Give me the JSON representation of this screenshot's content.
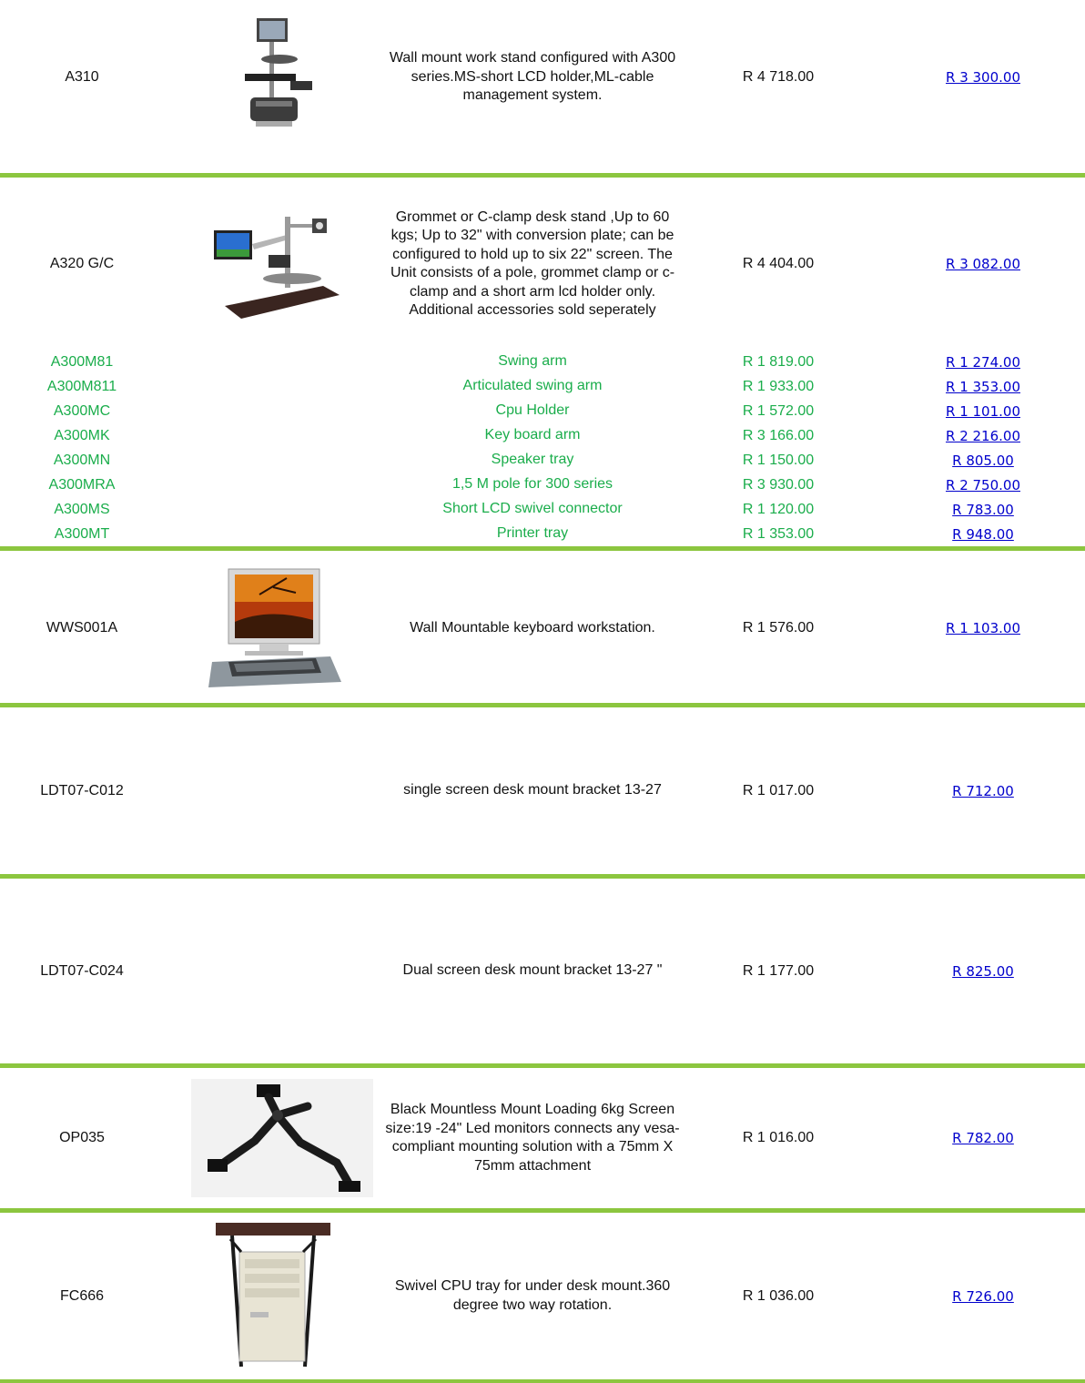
{
  "colors": {
    "separator": "#8cc63f",
    "accessory_text": "#1aad4b",
    "link": "#0000cc"
  },
  "products": [
    {
      "code": "A310",
      "image": "wall-mount-workstand-image",
      "description": "Wall mount work stand configured with A300 series.MS-short LCD holder,ML-cable management system.",
      "price": "R 4 718.00",
      "sale_price": "R 3 300.00"
    },
    {
      "code": "A320 G/C",
      "image": "desk-stand-image",
      "description": "Grommet or C-clamp desk stand ,Up to 60 kgs; Up to 32\" with conversion plate; can be configured to hold up to six 22\" screen. The Unit consists of a pole, grommet clamp or c-clamp and a short arm lcd holder only. Additional accessories sold seperately",
      "price": "R 4 404.00",
      "sale_price": "R 3 082.00"
    },
    {
      "code": "WWS001A",
      "image": "keyboard-workstation-image",
      "description": "Wall Mountable keyboard workstation.",
      "price": "R 1 576.00",
      "sale_price": "R 1 103.00"
    },
    {
      "code": "LDT07-C012",
      "image": "",
      "description": "single screen desk mount bracket 13-27",
      "price": "R 1 017.00",
      "sale_price": "R 712.00"
    },
    {
      "code": "LDT07-C024",
      "image": "",
      "description": "Dual screen desk mount bracket 13-27 \"",
      "price": "R 1 177.00",
      "sale_price": "R 825.00"
    },
    {
      "code": "OP035",
      "image": "mountless-mount-image",
      "description": "Black Mountless Mount  Loading 6kg Screen size:19 -24\"  Led monitors connects any vesa-compliant mounting solution with a 75mm X 75mm attachment",
      "price": "R 1 016.00",
      "sale_price": "R 782.00"
    },
    {
      "code": "FC666",
      "image": "cpu-tray-image",
      "description": "Swivel CPU tray for under desk mount.360 degree two way rotation.",
      "price": "R 1 036.00",
      "sale_price": "R 726.00"
    }
  ],
  "accessories": [
    {
      "code": "A300M81",
      "description": "Swing arm",
      "price": "R 1 819.00",
      "sale_price": "R 1 274.00"
    },
    {
      "code": "A300M811",
      "description": "Articulated swing arm",
      "price": "R 1 933.00",
      "sale_price": "R 1 353.00"
    },
    {
      "code": "A300MC",
      "description": "Cpu Holder",
      "price": "R 1 572.00",
      "sale_price": "R 1 101.00"
    },
    {
      "code": "A300MK",
      "description": "Key board arm",
      "price": "R 3 166.00",
      "sale_price": "R 2 216.00"
    },
    {
      "code": "A300MN",
      "description": "Speaker tray",
      "price": "R 1 150.00",
      "sale_price": "R 805.00"
    },
    {
      "code": "A300MRA",
      "description": "1,5 M pole for 300 series",
      "price": "R 3 930.00",
      "sale_price": "R 2 750.00"
    },
    {
      "code": "A300MS",
      "description": "Short LCD swivel connector",
      "price": "R 1 120.00",
      "sale_price": "R 783.00"
    },
    {
      "code": "A300MT",
      "description": "Printer tray",
      "price": "R 1 353.00",
      "sale_price": "R 948.00"
    }
  ]
}
